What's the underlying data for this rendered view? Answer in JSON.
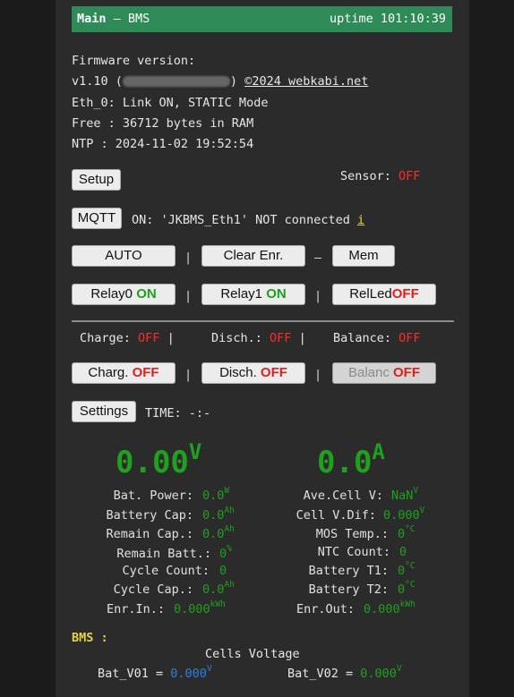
{
  "header": {
    "title_main": "Main",
    "title_rest": " – BMS",
    "uptime": "uptime 101:10:39"
  },
  "info": {
    "firmware_label": "Firmware version:",
    "fw_version": "v1.10 (",
    "fw_close": ")",
    "copyright": "©2024 webkabi.net",
    "eth": "Eth_0: Link ON, STATIC Mode",
    "free": "Free : 36712 bytes in RAM",
    "ntp": "NTP  : 2024-11-02 19:52:54"
  },
  "setup": {
    "button": "Setup",
    "sensor_label": "Sensor:",
    "sensor_value": "OFF"
  },
  "mqtt": {
    "button": "MQTT",
    "status": "ON: 'JKBMS_Eth1' NOT connected",
    "info": "i"
  },
  "row1": {
    "auto": "AUTO",
    "sep1": "|",
    "clear": "Clear Enr.",
    "sep2": "–",
    "mem": "Mem"
  },
  "row2": {
    "relay0": "Relay0",
    "relay0_state": "ON",
    "sep1": "|",
    "relay1": "Relay1",
    "relay1_state": "ON",
    "sep2": "|",
    "relled": "RelLed",
    "relled_state": "OFF"
  },
  "status_row": {
    "charge_label": "Charge:",
    "charge_value": "OFF",
    "sep1": "|",
    "disch_label": "Disch.:",
    "disch_value": "OFF",
    "sep2": "|",
    "balance_label": "Balance:",
    "balance_value": "OFF"
  },
  "row3": {
    "charg": "Charg.",
    "charg_state": "OFF",
    "sep1": "|",
    "disch": "Disch.",
    "disch_state": "OFF",
    "sep2": "|",
    "balanc": "Balanc",
    "balanc_state": "OFF"
  },
  "settings": {
    "button": "Settings",
    "time": "TIME: -:-"
  },
  "big": {
    "voltage": "0.00",
    "voltage_unit": "V",
    "current": "0.0",
    "current_unit": "A"
  },
  "left_stats": [
    {
      "label": "Bat. Power:",
      "value": "0.0",
      "unit": "W"
    },
    {
      "label": "Battery Cap:",
      "value": "0.0",
      "unit": "Ah"
    },
    {
      "label": "Remain Cap.:",
      "value": "0.0",
      "unit": "Ah"
    },
    {
      "label": "Remain Batt.:",
      "value": "0",
      "unit": "%"
    },
    {
      "label": "Cycle Count:",
      "value": "0",
      "unit": ""
    },
    {
      "label": "Cycle Cap.:",
      "value": "0.0",
      "unit": "Ah"
    },
    {
      "label": "Enr.In.:",
      "value": "0.000",
      "unit": "kWh"
    }
  ],
  "right_stats": [
    {
      "label": "Ave.Cell V:",
      "value": "NaN",
      "unit": "V"
    },
    {
      "label": "Cell V.Dif:",
      "value": "0.000",
      "unit": "V"
    },
    {
      "label": "MOS Temp.:",
      "value": "0",
      "unit": "°C"
    },
    {
      "label": "NTC Count:",
      "value": "0",
      "unit": ""
    },
    {
      "label": "Battery T1:",
      "value": "0",
      "unit": "°C"
    },
    {
      "label": "Battery T2:",
      "value": "0",
      "unit": "°C"
    },
    {
      "label": "Enr.Out:",
      "value": "0.000",
      "unit": "kWh"
    }
  ],
  "bms": {
    "label": "BMS :",
    "cells_title": "Cells Voltage"
  },
  "cells": [
    {
      "label": "Bat_V01 =",
      "value": "0.000",
      "unit": "V",
      "color": "#2e7fe0"
    },
    {
      "label": "Bat_V02 =",
      "value": "0.000",
      "unit": "V",
      "color": "#1fa01f"
    }
  ],
  "colors": {
    "green": "#2e8b57",
    "on": "#1fa01f",
    "off": "#e11d1d",
    "accent": "#e7d43a",
    "blue": "#2e7fe0"
  }
}
